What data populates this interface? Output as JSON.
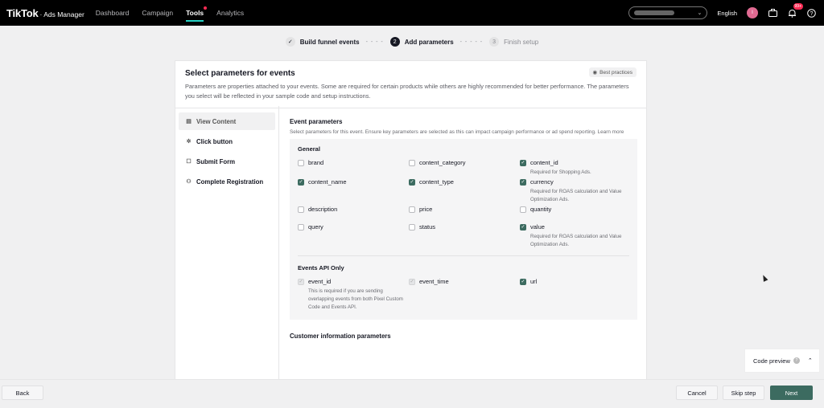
{
  "topbar": {
    "brand_main": "TikTok",
    "brand_sub": "· Ads Manager",
    "nav": [
      {
        "label": "Dashboard",
        "active": false
      },
      {
        "label": "Campaign",
        "active": false
      },
      {
        "label": "Tools",
        "active": true
      },
      {
        "label": "Analytics",
        "active": false
      }
    ],
    "language": "English",
    "avatar_letter": "I",
    "notification_badge": "99+"
  },
  "stepper": [
    {
      "label": "Build funnel events",
      "state": "done",
      "symbol": "✓"
    },
    {
      "label": "Add parameters",
      "state": "active",
      "symbol": "2"
    },
    {
      "label": "Finish setup",
      "state": "todo",
      "symbol": "3"
    }
  ],
  "card": {
    "title": "Select parameters for events",
    "best_practices": "Best practices",
    "description": "Parameters are properties attached to your events. Some are required for certain products while others are highly recommended for better performance. The parameters you select will be reflected in your sample code and setup instructions."
  },
  "sidebar": {
    "items": [
      {
        "label": "View Content",
        "icon": "view-icon",
        "active": true
      },
      {
        "label": "Click button",
        "icon": "click-icon",
        "active": false
      },
      {
        "label": "Submit Form",
        "icon": "form-icon",
        "active": false
      },
      {
        "label": "Complete Registration",
        "icon": "user-icon",
        "active": false
      }
    ]
  },
  "main": {
    "event_params_title": "Event parameters",
    "event_params_desc": "Select parameters for this event. Ensure key parameters are selected as this can impact campaign performance or ad spend reporting. Learn more",
    "general_title": "General",
    "general": [
      {
        "label": "brand",
        "checked": false,
        "note": ""
      },
      {
        "label": "content_category",
        "checked": false,
        "note": ""
      },
      {
        "label": "content_id",
        "checked": true,
        "note": "Required for Shopping Ads."
      },
      {
        "label": "content_name",
        "checked": true,
        "note": ""
      },
      {
        "label": "content_type",
        "checked": true,
        "note": ""
      },
      {
        "label": "currency",
        "checked": true,
        "note": "Required for ROAS calculation and Value Optimization Ads."
      },
      {
        "label": "description",
        "checked": false,
        "note": ""
      },
      {
        "label": "price",
        "checked": false,
        "note": ""
      },
      {
        "label": "quantity",
        "checked": false,
        "note": ""
      },
      {
        "label": "query",
        "checked": false,
        "note": ""
      },
      {
        "label": "status",
        "checked": false,
        "note": ""
      },
      {
        "label": "value",
        "checked": true,
        "note": "Required for ROAS calculation and Value Optimization Ads."
      }
    ],
    "api_title": "Events API Only",
    "api": [
      {
        "label": "event_id",
        "checked": true,
        "disabled": true,
        "note": "This is required if you are sending overlapping events from both Pixel Custom Code and Events API."
      },
      {
        "label": "event_time",
        "checked": true,
        "disabled": true,
        "note": ""
      },
      {
        "label": "url",
        "checked": true,
        "disabled": false,
        "note": ""
      }
    ],
    "customer_title": "Customer information parameters"
  },
  "code_preview": "Code preview",
  "footer": {
    "back": "Back",
    "cancel": "Cancel",
    "skip": "Skip step",
    "next": "Next"
  },
  "colors": {
    "accent": "#3c6b60",
    "nav_underline": "#25d0c4",
    "badge": "#fe2c55"
  }
}
